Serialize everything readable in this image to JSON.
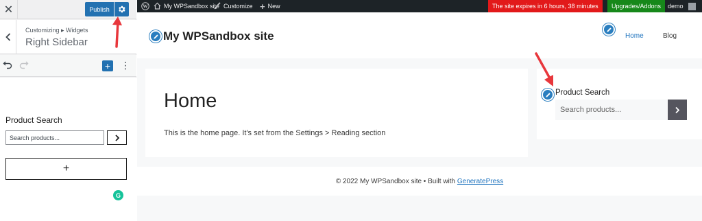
{
  "customizer": {
    "close_icon": "close-icon",
    "publish_label": "Publish",
    "breadcrumb": "Customizing ▸ Widgets",
    "section_title": "Right Sidebar",
    "add_block_label": "+",
    "more_label": "⋮",
    "widget_title": "Product Search",
    "search_placeholder": "Search products...",
    "search_button_glyph": "›",
    "add_area_label": "+",
    "grammarly_glyph": "G"
  },
  "adminbar": {
    "site_name": "My WPSandbox site",
    "customize_label": "Customize",
    "new_label": "New",
    "expiry_notice": "The site expires in  6 hours, 38 minutes",
    "upgrades_label": "Upgrades/Addons",
    "user_label": "demo",
    "colors": {
      "expiry_bg": "#e2191a",
      "upgrade_bg": "#16881a",
      "bar_bg": "#1d2327"
    }
  },
  "preview": {
    "site_title": "My WPSandbox site",
    "nav": [
      {
        "label": "Home",
        "active": true
      },
      {
        "label": "Blog",
        "active": false
      }
    ],
    "page_title": "Home",
    "page_text": "This is the home page. It's set from the Settings > Reading section",
    "widget": {
      "title": "Product Search",
      "placeholder": "Search products...",
      "button_glyph": "›"
    },
    "footer": {
      "text": "© 2022 My WPSandbox site • Built with ",
      "link": "GeneratePress"
    }
  },
  "accent_color": "#2271b1"
}
